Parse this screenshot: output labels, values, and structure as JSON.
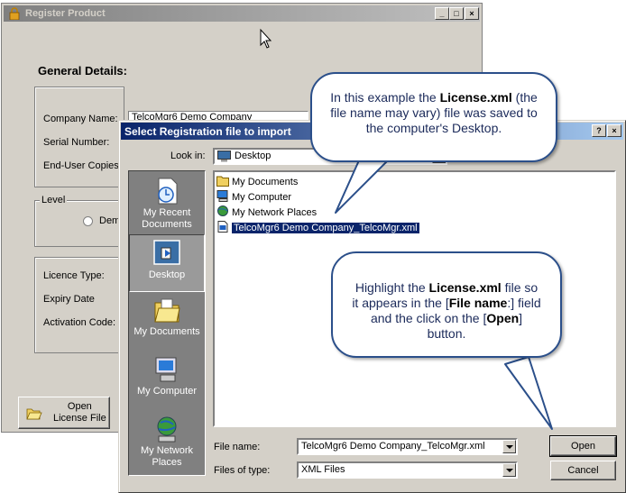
{
  "register": {
    "title": "Register Product",
    "heading": "General Details:",
    "company_label": "Company Name:",
    "company_value": "TelcoMgr6 Demo Company",
    "serial_label": "Serial Number:",
    "enduser_label": "End-User Copies:",
    "level_caption": "Level",
    "radio_label": "Dem",
    "licence_type_label": "Licence Type:",
    "expiry_label": "Expiry Date",
    "activation_label": "Activation Code:",
    "open_button_line1": "Open",
    "open_button_line2": "License File",
    "minimize": "_",
    "maximize": "□",
    "close": "×"
  },
  "dialog": {
    "title": "Select Registration file to import",
    "help": "?",
    "close": "×",
    "look_in_label": "Look in:",
    "look_in_value": "Desktop",
    "places": [
      {
        "line1": "My Recent",
        "line2": "Documents"
      },
      {
        "line1": "Desktop",
        "line2": ""
      },
      {
        "line1": "My Documents",
        "line2": ""
      },
      {
        "line1": "My Computer",
        "line2": ""
      },
      {
        "line1": "My Network",
        "line2": "Places"
      }
    ],
    "files": [
      {
        "name": "My Documents"
      },
      {
        "name": "My Computer"
      },
      {
        "name": "My Network Places"
      },
      {
        "name": "TelcoMgr6 Demo Company_TelcoMgr.xml"
      }
    ],
    "file_name_label": "File name:",
    "file_name_value": "TelcoMgr6 Demo Company_TelcoMgr.xml",
    "files_of_type_label": "Files of type:",
    "files_of_type_value": "XML Files",
    "open_button": "Open",
    "cancel_button": "Cancel"
  },
  "callouts": {
    "top": {
      "part1": "In this example the ",
      "bold1": "License.xml",
      "part2": " (the file name may vary) file was saved to the computer's Desktop."
    },
    "bottom": {
      "part1": "Highlight the ",
      "bold1": "License.xml",
      "part2": " file so it appears in the [",
      "bold2": "File name",
      "part3": ":] field and the click on the [",
      "bold3": "Open",
      "part4": "] button."
    }
  },
  "colors": {
    "active_title": "#0a246a",
    "inactive_title": "#808080",
    "callout_border": "#2b4f8a"
  }
}
